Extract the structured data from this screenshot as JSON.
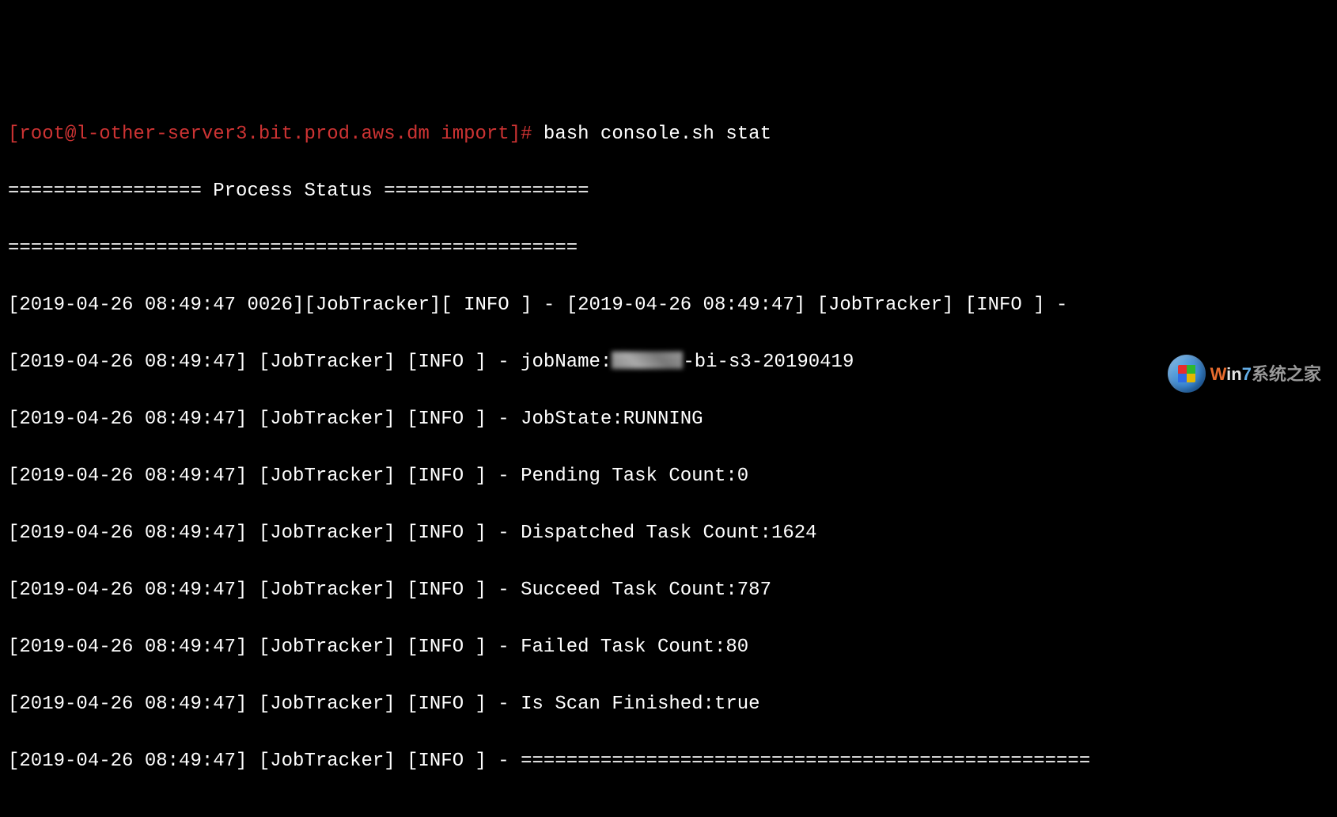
{
  "prompt": {
    "user_host_path": "[root@l-other-server3.bit.prod.aws.dm import]# ",
    "command": "bash console.sh stat"
  },
  "header": {
    "title_line": "================= Process Status ==================",
    "separator": "=================================================="
  },
  "log": {
    "first_line": "[2019-04-26 08:49:47 0026][JobTracker][ INFO ] - [2019-04-26 08:49:47] [JobTracker] [INFO ] -",
    "entries": [
      {
        "prefix": "[2019-04-26 08:49:47] [JobTracker] [INFO ] - ",
        "label": "jobName:",
        "redacted": true,
        "suffix": "-bi-s3-20190419"
      },
      {
        "prefix": "[2019-04-26 08:49:47] [JobTracker] [INFO ] - ",
        "label": "JobState:",
        "value": "RUNNING"
      },
      {
        "prefix": "[2019-04-26 08:49:47] [JobTracker] [INFO ] - ",
        "label": "Pending Task Count:",
        "value": "0"
      },
      {
        "prefix": "[2019-04-26 08:49:47] [JobTracker] [INFO ] - ",
        "label": "Dispatched Task Count:",
        "value": "1624"
      },
      {
        "prefix": "[2019-04-26 08:49:47] [JobTracker] [INFO ] - ",
        "label": "Succeed Task Count:",
        "value": "787"
      },
      {
        "prefix": "[2019-04-26 08:49:47] [JobTracker] [INFO ] - ",
        "label": "Failed Task Count:",
        "value": "80"
      },
      {
        "prefix": "[2019-04-26 08:49:47] [JobTracker] [INFO ] - ",
        "label": "Is Scan Finished:",
        "value": "true"
      },
      {
        "prefix": "[2019-04-26 08:49:47] [JobTracker] [INFO ] - ",
        "label": "",
        "value": "=================================================="
      }
    ]
  },
  "watermark": {
    "text_w": "W",
    "text_in": "in",
    "text_7": "7",
    "text_rest": "系统之家"
  }
}
